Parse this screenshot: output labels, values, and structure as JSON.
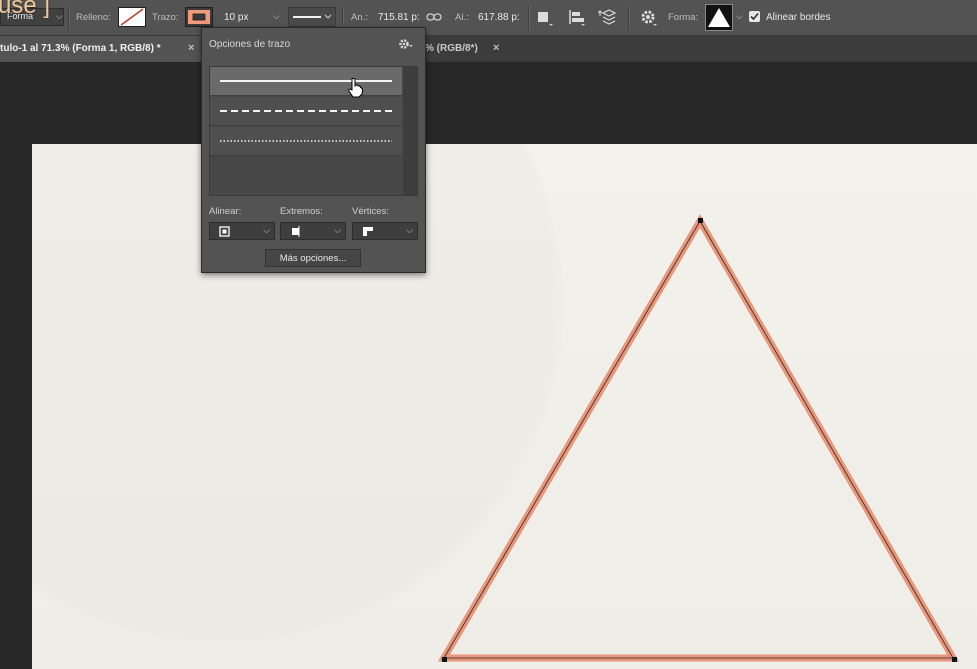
{
  "mouse_label": "use ]",
  "options_bar": {
    "mode_select": "Forma",
    "fill_label": "Relleno:",
    "stroke_label": "Trazo:",
    "stroke_width": "10 px",
    "width_label": "An.:",
    "width_value": "715.81 p:",
    "height_label": "Al.:",
    "height_value": "617.88 p:",
    "shape_label": "Forma:",
    "align_edges_label": "Alinear bordes",
    "align_edges_checked": true,
    "colors": {
      "stroke": "#e8957a",
      "bar": "#535353"
    }
  },
  "tabs": [
    {
      "label": "tulo-1 al 71.3% (Forma 1, RGB/8) *",
      "close": "×"
    },
    {
      "label": "% (RGB/8*)",
      "close": "×"
    }
  ],
  "stroke_panel": {
    "title": "Opciones de trazo",
    "align_label": "Alinear:",
    "caps_label": "Extremos:",
    "corners_label": "Vértices:",
    "more_button": "Más opciones...",
    "styles": [
      "solid",
      "dashed",
      "dotted"
    ],
    "selected_style": "solid"
  },
  "canvas": {
    "shape": "triangle",
    "stroke_color": "#e8957a",
    "paper_color": "#f1efea"
  }
}
